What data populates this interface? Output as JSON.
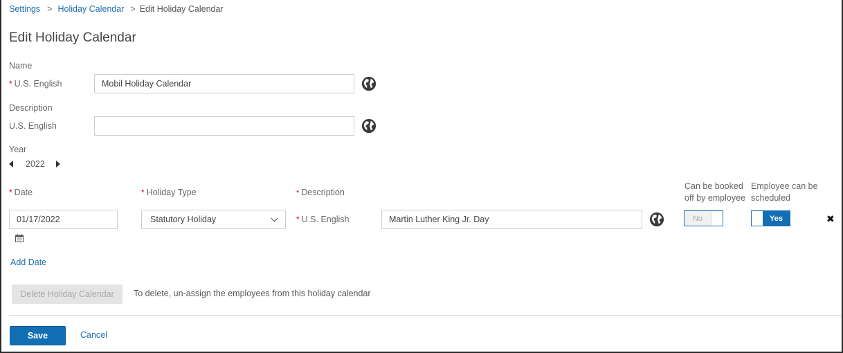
{
  "breadcrumb": {
    "items": [
      "Settings",
      "Holiday Calendar"
    ],
    "separator": ">",
    "current": "Edit Holiday Calendar"
  },
  "page": {
    "title": "Edit Holiday Calendar"
  },
  "name_section": {
    "label": "Name",
    "field_label": "U.S. English",
    "required_mark": "*",
    "value": "Mobil Holiday Calendar",
    "placeholder": ""
  },
  "description_section": {
    "label": "Description",
    "field_label": "U.S. English",
    "value": "",
    "placeholder": ""
  },
  "year": {
    "label": "Year",
    "value": "2022"
  },
  "dates_table": {
    "columns": {
      "date": "Date",
      "holiday_type": "Holiday Type",
      "description": "Description",
      "can_book_off": "Can be booked off by employee",
      "can_schedule": "Employee can be scheduled"
    },
    "required_mark": "*",
    "rows": [
      {
        "date": "01/17/2022",
        "holiday_type": "Statutory Holiday",
        "description_lang": "U.S. English",
        "description": "Martin Luther King Jr. Day",
        "can_book_off": "No",
        "can_schedule": "Yes"
      }
    ],
    "add_label": "Add Date"
  },
  "delete": {
    "button_label": "Delete Holiday Calendar",
    "hint": "To delete, un-assign the employees from this holiday calendar"
  },
  "footer": {
    "save_label": "Save",
    "cancel_label": "Cancel"
  },
  "colors": {
    "accent": "#136fb3",
    "link": "#1f6fb2",
    "required": "#d0021b"
  }
}
